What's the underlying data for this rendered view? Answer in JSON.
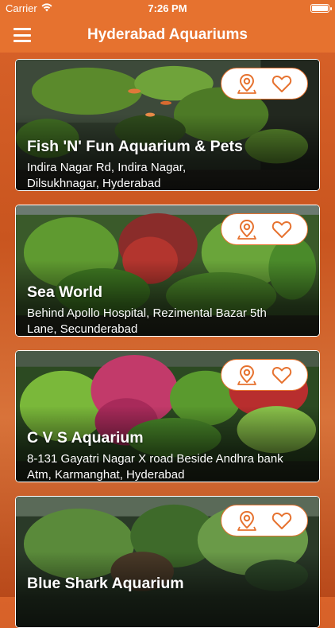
{
  "status": {
    "carrier": "Carrier",
    "time": "7:26 PM"
  },
  "header": {
    "title": "Hyderabad Aquariums",
    "menu_icon": "hamburger-menu-icon"
  },
  "colors": {
    "accent": "#e6722f",
    "card_border": "#ffffff"
  },
  "aquariums": [
    {
      "name": "Fish 'N' Fun Aquarium & Pets",
      "address_line1": "Indira Nagar Rd, Indira Nagar,",
      "address_line2": "Dilsukhnagar, Hyderabad"
    },
    {
      "name": "Sea World",
      "address_line1": "Behind Apollo Hospital, Rezimental Bazar 5th",
      "address_line2": "Lane, Secunderabad"
    },
    {
      "name": "C V S Aquarium",
      "address_line1": "8-131 Gayatri Nagar X road Beside Andhra bank",
      "address_line2": "Atm, Karmanghat, Hyderabad"
    },
    {
      "name": "Blue Shark Aquarium",
      "address_line1": "",
      "address_line2": ""
    }
  ],
  "card_icons": {
    "location": "map-pin-icon",
    "favorite": "heart-icon"
  }
}
